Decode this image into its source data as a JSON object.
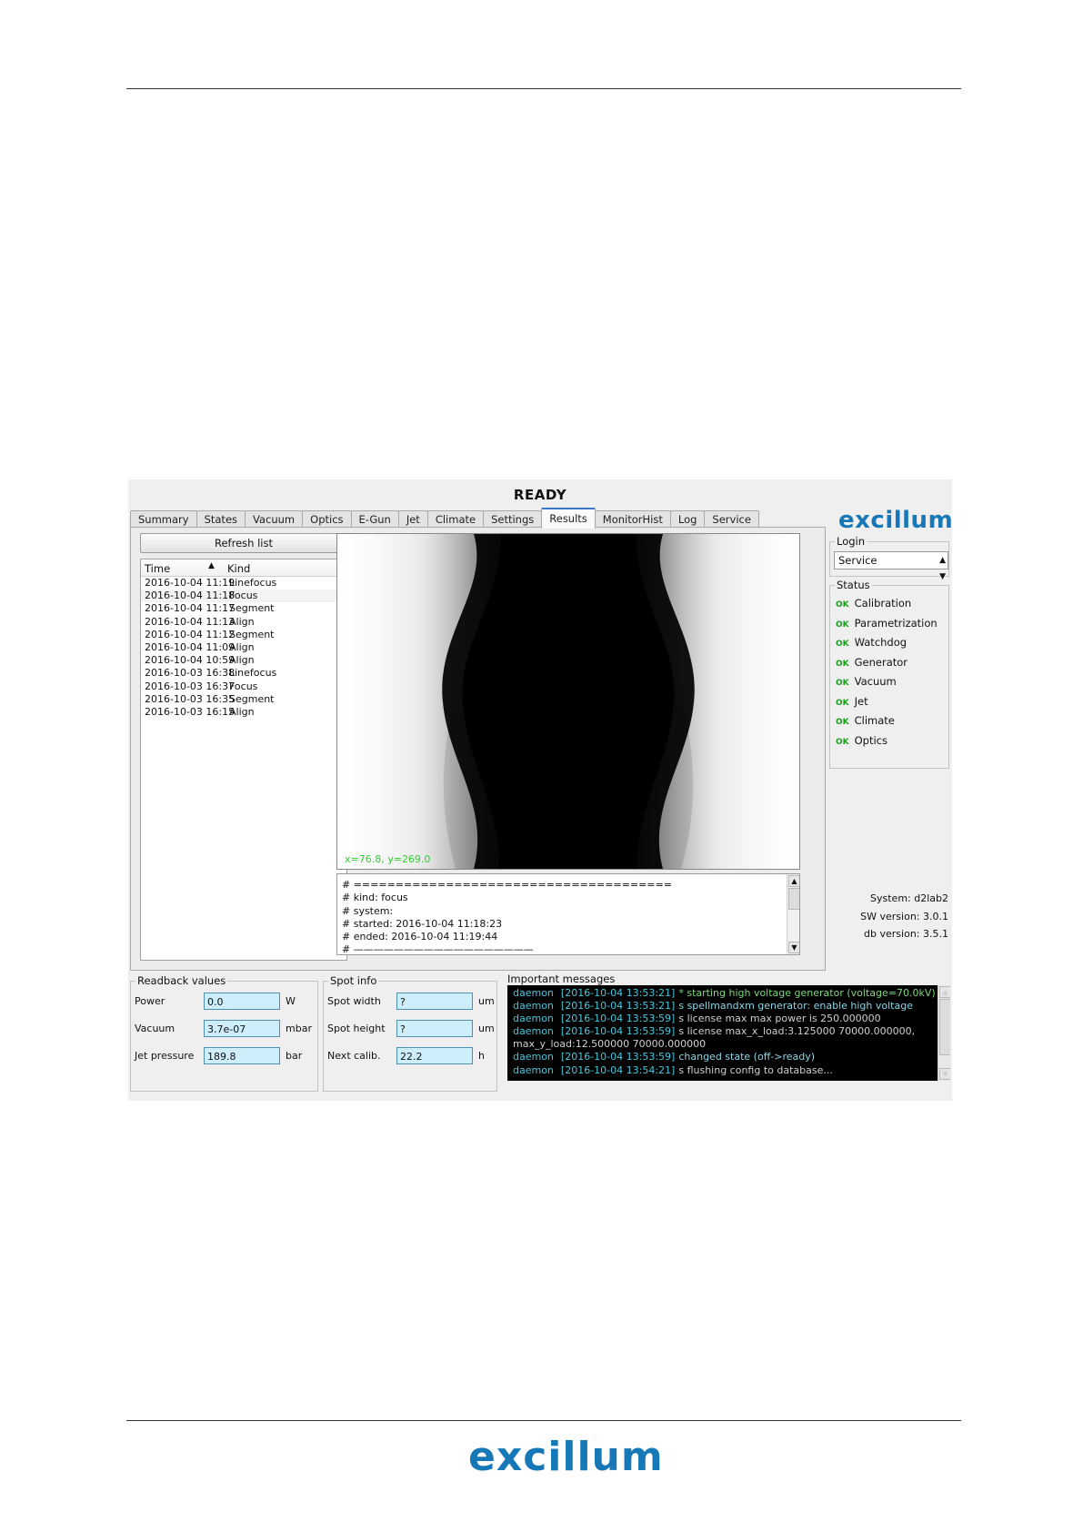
{
  "app": {
    "title": "READY",
    "tabs": [
      "Summary",
      "States",
      "Vacuum",
      "Optics",
      "E-Gun",
      "Jet",
      "Climate",
      "Settings",
      "Results",
      "MonitorHist",
      "Log",
      "Service"
    ],
    "active_tab": "Results",
    "logo_text": "excillum",
    "refresh_label": "Refresh list",
    "list": {
      "headers": {
        "time": "Time",
        "kind": "Kind"
      },
      "rows": [
        {
          "time": "2016-10-04 11:19",
          "kind": "Linefocus"
        },
        {
          "time": "2016-10-04 11:18",
          "kind": "Focus"
        },
        {
          "time": "2016-10-04 11:17",
          "kind": "Segment"
        },
        {
          "time": "2016-10-04 11:13",
          "kind": "Align"
        },
        {
          "time": "2016-10-04 11:12",
          "kind": "Segment"
        },
        {
          "time": "2016-10-04 11:09",
          "kind": "Align"
        },
        {
          "time": "2016-10-04 10:59",
          "kind": "Align"
        },
        {
          "time": "2016-10-03 16:38",
          "kind": "Linefocus"
        },
        {
          "time": "2016-10-03 16:37",
          "kind": "Focus"
        },
        {
          "time": "2016-10-03 16:35",
          "kind": "Segment"
        },
        {
          "time": "2016-10-03 16:15",
          "kind": "Align"
        }
      ],
      "selected_index": 1
    },
    "coord_readout": "x=76.8, y=269.0",
    "report_lines": [
      "# ======================================",
      "# kind: focus",
      "# system:",
      "# started: 2016-10-04 11:18:23",
      "# ended: 2016-10-04 11:19:44",
      "# ——————————————————"
    ],
    "login": {
      "title": "Login",
      "value": "Service"
    },
    "status": {
      "title": "Status",
      "ok_label": "OK",
      "items": [
        "Calibration",
        "Parametrization",
        "Watchdog",
        "Generator",
        "Vacuum",
        "Jet",
        "Climate",
        "Optics"
      ]
    },
    "system_info": {
      "system": "System: d2lab2",
      "sw_version": "SW version: 3.0.1",
      "db_version": "db version: 3.5.1"
    },
    "readback": {
      "title": "Readback values",
      "rows": [
        {
          "label": "Power",
          "value": "0.0",
          "unit": "W"
        },
        {
          "label": "Vacuum",
          "value": "3.7e-07",
          "unit": "mbar"
        },
        {
          "label": "Jet pressure",
          "value": "189.8",
          "unit": "bar"
        }
      ]
    },
    "spot": {
      "title": "Spot info",
      "rows": [
        {
          "label": "Spot width",
          "value": "?",
          "unit": "um"
        },
        {
          "label": "Spot height",
          "value": "?",
          "unit": "um"
        },
        {
          "label": "Next calib.",
          "value": "22.2",
          "unit": "h"
        }
      ]
    },
    "messages": {
      "title": "Important messages",
      "lines": [
        {
          "src": "daemon",
          "time": "[2016-10-04 13:53:21]",
          "text": "* starting high voltage generator (voltage=70.0kV)",
          "tone": "green"
        },
        {
          "src": "daemon",
          "time": "[2016-10-04 13:53:21]",
          "text": "s spellmandxm generator: enable high voltage",
          "tone": "cyan"
        },
        {
          "src": "daemon",
          "time": "[2016-10-04 13:53:59]",
          "text": "s license max max power is 250.000000",
          "tone": "plain"
        },
        {
          "src": "daemon",
          "time": "[2016-10-04 13:53:59]",
          "text": "s license max_x_load:3.125000 70000.000000,",
          "tone": "plain"
        },
        {
          "src": "",
          "time": "",
          "text": "max_y_load:12.500000 70000.000000",
          "tone": "plain"
        },
        {
          "src": "daemon",
          "time": "[2016-10-04 13:53:59]",
          "text": "changed state (off->ready)",
          "tone": "cyan"
        },
        {
          "src": "daemon",
          "time": "[2016-10-04 13:54:21]",
          "text": "s flushing config to database...",
          "tone": "plain"
        }
      ]
    }
  },
  "footer": {
    "logo_text": "excillum"
  },
  "colors": {
    "brand": "#1778b8",
    "ok": "#1a9e1a",
    "input_bg": "#cdeefa",
    "active_tab": "#3a78c9"
  }
}
